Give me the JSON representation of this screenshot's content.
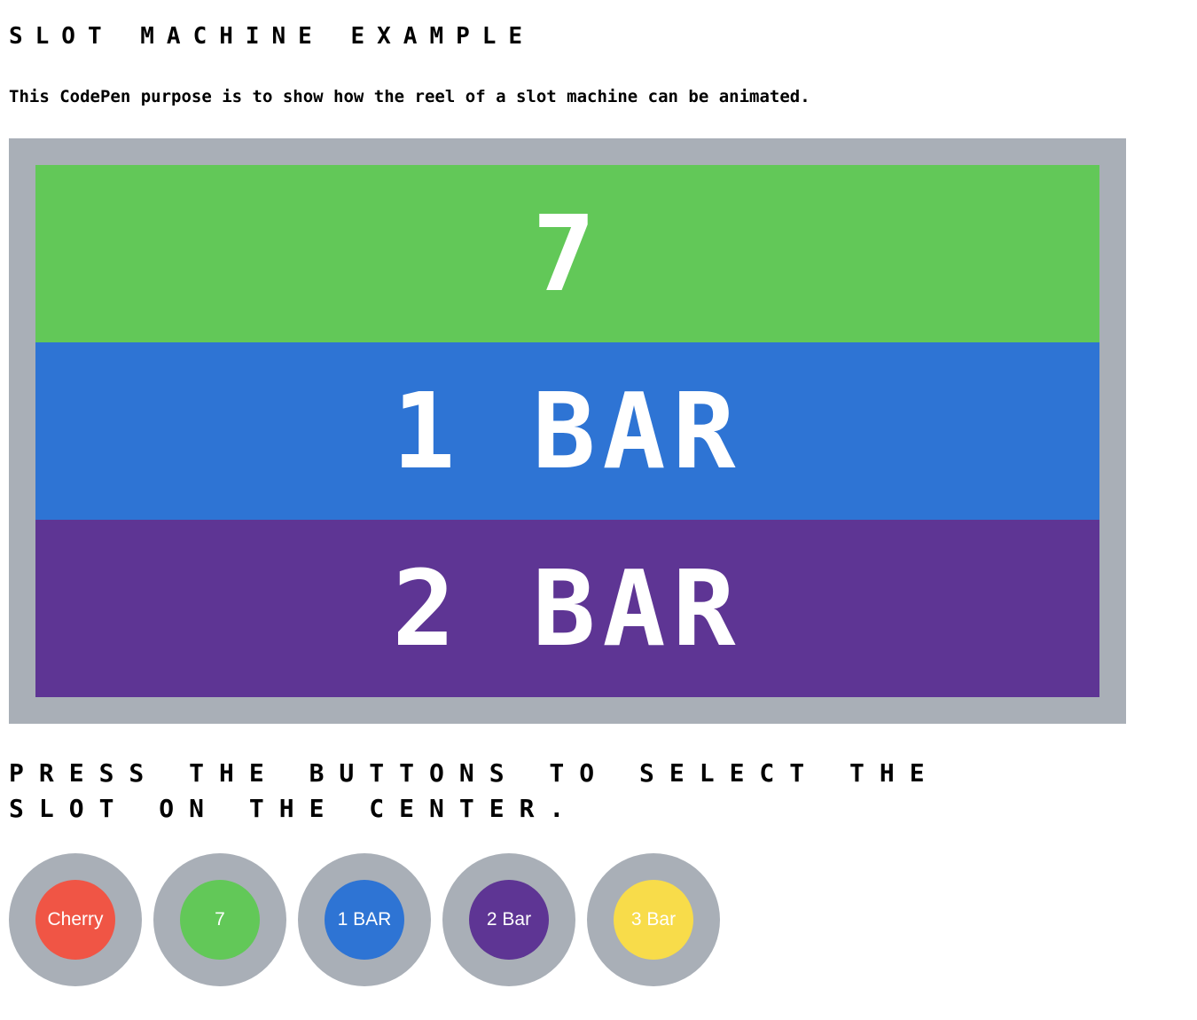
{
  "page": {
    "title": "Slot Machine Example",
    "intro": "This CodePen purpose is to show how the reel of a slot machine can be animated.",
    "instructions": "Press the buttons to select the slot on the center."
  },
  "reel": {
    "slots": [
      {
        "label": "7",
        "color": "#62c858"
      },
      {
        "label": "1 BAR",
        "color": "#2e74d4"
      },
      {
        "label": "2 BAR",
        "color": "#5e3594"
      }
    ],
    "frame_color": "#a9afb7"
  },
  "buttons": [
    {
      "label": "Cherry",
      "color": "#f05545"
    },
    {
      "label": "7",
      "color": "#62c858"
    },
    {
      "label": "1 BAR",
      "color": "#2e74d4"
    },
    {
      "label": "2 Bar",
      "color": "#5e3594"
    },
    {
      "label": "3 Bar",
      "color": "#f8dc4a"
    }
  ]
}
